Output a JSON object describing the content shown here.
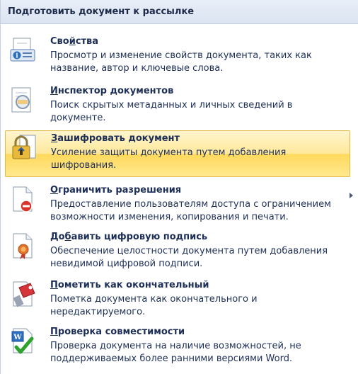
{
  "header": {
    "title": "Подготовить документ к рассылке"
  },
  "items": [
    {
      "title_pre": "Сво",
      "title_mnemonic": "й",
      "title_post": "ства",
      "desc": "Просмотр и изменение свойств документа, таких как название, автор и ключевые слова.",
      "icon": "document-properties-icon"
    },
    {
      "title_pre": "",
      "title_mnemonic": "И",
      "title_post": "нспектор документов",
      "desc": "Поиск скрытых метаданных и личных сведений в документе.",
      "icon": "document-inspector-icon"
    },
    {
      "title_pre": "",
      "title_mnemonic": "З",
      "title_post": "ашифровать документ",
      "desc": "Усиление защиты документа путем добавления шифрования.",
      "icon": "lock-document-icon",
      "highlighted": true
    },
    {
      "title_pre": "",
      "title_mnemonic": "О",
      "title_post": "граничить разрешения",
      "desc": "Предоставление пользователям доступа с ограничением возможности изменения, копирования и печати.",
      "icon": "restrict-permission-icon",
      "has_submenu": true
    },
    {
      "title_pre": "До",
      "title_mnemonic": "б",
      "title_post": "авить цифровую подпись",
      "desc": "Обеспечение целостности документа путем добавления невидимой цифровой подписи.",
      "icon": "digital-signature-icon"
    },
    {
      "title_pre": "",
      "title_mnemonic": "П",
      "title_post": "ометить как окончательный",
      "desc": "Пометка документа как окончательного и нередактируемого.",
      "icon": "mark-final-icon"
    },
    {
      "title_pre": "",
      "title_mnemonic": "П",
      "title_post": "роверка совместимости",
      "desc": "Проверка документа на наличие возможностей, не поддерживаемых более ранними версиями Word.",
      "icon": "compatibility-checker-icon"
    }
  ],
  "colors": {
    "highlight_top": "#fff6cf",
    "highlight_bottom": "#ffd95c",
    "highlight_border": "#e3b845",
    "text": "#1e2f57",
    "header_bg": "#dbe4f2"
  }
}
